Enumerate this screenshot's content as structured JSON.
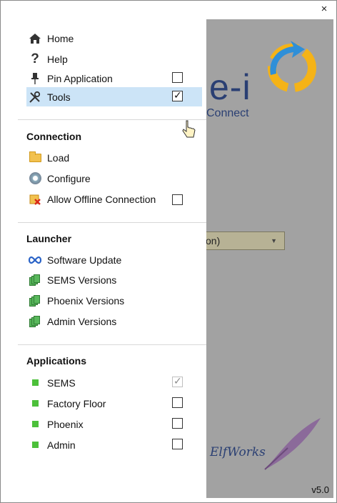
{
  "window": {
    "close_glyph": "×",
    "version": "v5.0"
  },
  "background_app": {
    "title": "e-i",
    "subtitle": "Connect",
    "select_value": "on)",
    "signature": "y ElfWorks"
  },
  "menu": {
    "top_items": [
      {
        "label": "Home",
        "icon": "home-icon"
      },
      {
        "label": "Help",
        "icon": "help-icon"
      },
      {
        "label": "Pin Application",
        "icon": "pin-icon",
        "checked": false
      },
      {
        "label": "Tools",
        "icon": "tools-icon",
        "checked": true,
        "highlighted": true
      }
    ],
    "connection": {
      "header": "Connection",
      "items": [
        {
          "label": "Load",
          "icon": "folder-open-icon"
        },
        {
          "label": "Configure",
          "icon": "configure-icon"
        },
        {
          "label": "Allow Offline Connection",
          "icon": "offline-icon",
          "checked": false
        }
      ]
    },
    "launcher": {
      "header": "Launcher",
      "items": [
        {
          "label": "Software Update",
          "icon": "infinity-icon"
        },
        {
          "label": "SEMS Versions",
          "icon": "versions-icon"
        },
        {
          "label": "Phoenix Versions",
          "icon": "versions-icon"
        },
        {
          "label": "Admin Versions",
          "icon": "versions-icon"
        }
      ]
    },
    "applications": {
      "header": "Applications",
      "items": [
        {
          "label": "SEMS",
          "checked": true,
          "disabled": true
        },
        {
          "label": "Factory Floor",
          "checked": false
        },
        {
          "label": "Phoenix",
          "checked": false
        },
        {
          "label": "Admin",
          "checked": false
        }
      ]
    }
  }
}
